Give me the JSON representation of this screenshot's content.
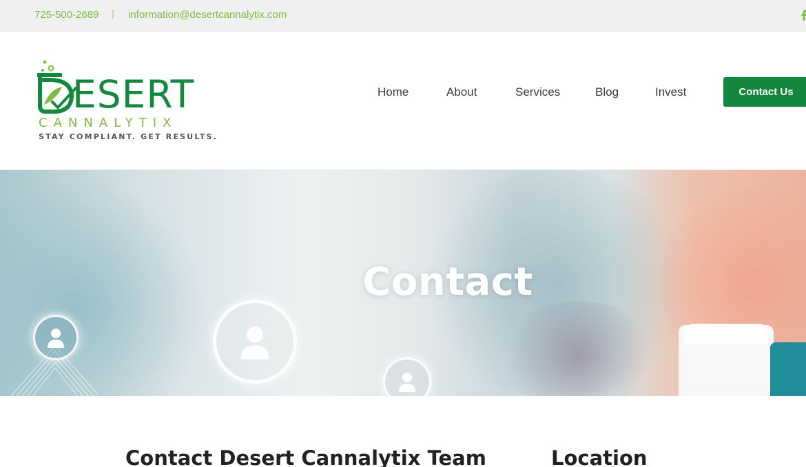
{
  "topbar": {
    "phone": "725-500-2689",
    "separator": "|",
    "email": "information@desertcannalytix.com",
    "social_icon": "facebook-icon"
  },
  "logo": {
    "word1": "ESERT",
    "word2": "CANNALYTIX",
    "tagline": "STAY COMPLIANT. GET RESULTS."
  },
  "nav": {
    "items": [
      {
        "label": "Home"
      },
      {
        "label": "About"
      },
      {
        "label": "Services"
      },
      {
        "label": "Blog"
      },
      {
        "label": "Invest"
      }
    ],
    "cta_label": "Contact Us"
  },
  "hero": {
    "title": "Contact"
  },
  "sections": {
    "left_heading": "Contact Desert Cannalytix Team",
    "right_heading": "Location"
  },
  "colors": {
    "brand_green": "#13873d",
    "accent_green": "#7bbd3c",
    "topbar_bg": "#f0f0f0",
    "text_dark": "#3a3a3a"
  }
}
